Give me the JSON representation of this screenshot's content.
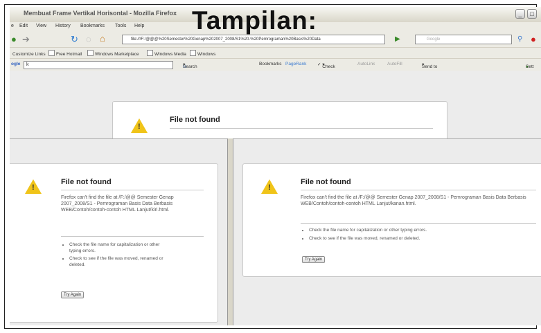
{
  "slide_title": "Tampilan:",
  "window": {
    "title": "Membuat Frame Vertikal Horisontal - Mozilla Firefox",
    "buttons": [
      "_",
      "□"
    ]
  },
  "menu": [
    "Edit",
    "View",
    "History",
    "Bookmarks",
    "Tools",
    "Help"
  ],
  "menu_partial": "e",
  "navbar": {
    "url": "file:///F:/@@@%20Semester%20Genap%202007_2008/S1%20-%20Pemrograman%20Basis%20Data",
    "search_placeholder": "Google"
  },
  "bookmarks": [
    "Customize Links",
    "Free Hotmail",
    "Windows Marketplace",
    "Windows Media",
    "Windows"
  ],
  "google_toolbar": {
    "label": "ogle",
    "search_value": "k",
    "items": [
      "Search",
      "Bookmarks",
      "PageRank",
      "Check",
      "AutoLink",
      "AutoFill",
      "Send to",
      "Sett"
    ]
  },
  "top_frame": {
    "title": "File not found"
  },
  "frame_left": {
    "title": "File not found",
    "message": "Firefox can't find the file at /F:/@@ Semester Genap 2007_2008/S1 - Pemrograman Basis Data Berbasis WEB/Contoh/contoh-contoh HTML Lanjut/kiri.html.",
    "bullets": [
      "Check the file name for capitalization or other typing errors.",
      "Check to see if the file was moved, renamed or deleted."
    ],
    "button": "Try Again"
  },
  "frame_right": {
    "title": "File not found",
    "message": "Firefox can't find the file at /F:/@@ Semester Genap 2007_2008/S1 - Pemrograman Basis Data Berbasis WEB/Contoh/contoh-contoh HTML Lanjut/kanan.html.",
    "bullets": [
      "Check the file name for capitalization or other typing errors.",
      "Check to see if the file was moved, renamed or deleted."
    ],
    "button": "Try Again"
  },
  "icons": [
    "back-icon",
    "forward-icon",
    "reload-icon",
    "stop-icon",
    "home-icon",
    "go-icon",
    "search-icon",
    "warning-icon"
  ]
}
